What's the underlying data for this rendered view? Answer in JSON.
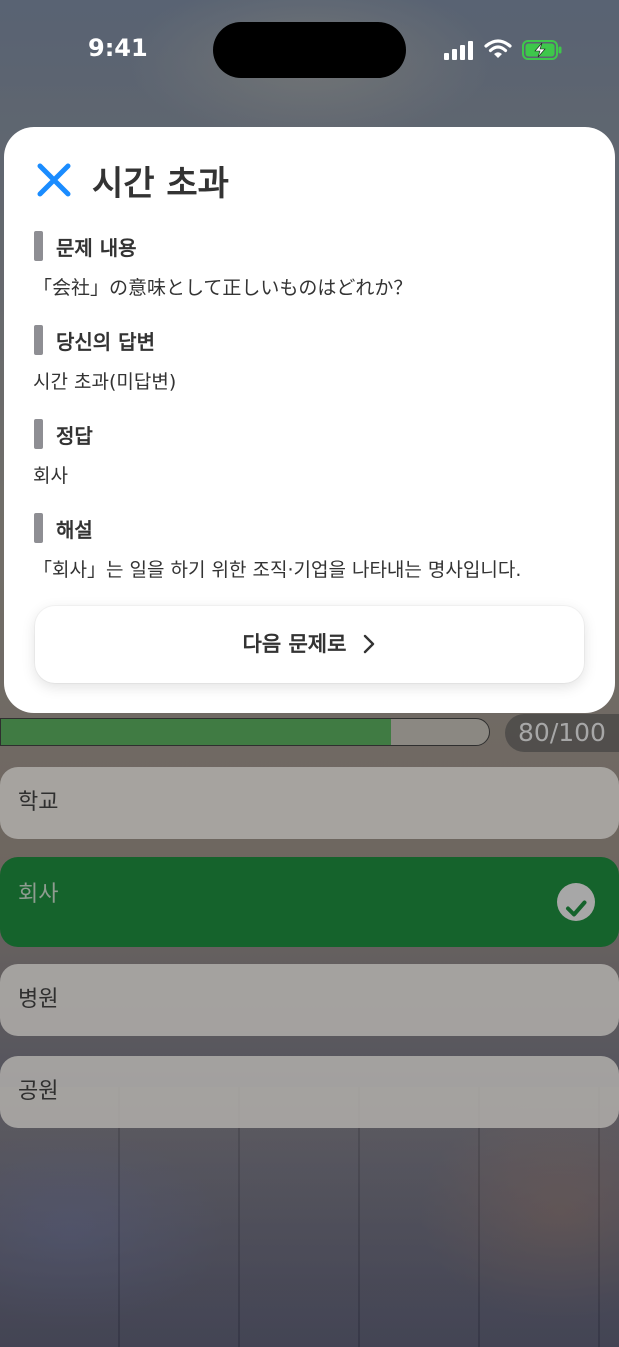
{
  "status_bar": {
    "time": "9:41"
  },
  "modal": {
    "title": "시간 초과",
    "sections": [
      {
        "label": "문제 내용",
        "value": "「会社」の意味として正しいものはどれか？"
      },
      {
        "label": "당신의 답변",
        "value": "시간 초과(미답변)"
      },
      {
        "label": "정답",
        "value": "회사"
      },
      {
        "label": "해설",
        "value": "「회사」는 일을 하기 위한 조직·기업을 나타내는 명사입니다."
      }
    ],
    "next_button": "다음 문제로"
  },
  "game": {
    "progress_fraction": 0.8,
    "score": "80/100",
    "options": [
      {
        "label": "학교",
        "correct": false
      },
      {
        "label": "회사",
        "correct": true
      },
      {
        "label": "병원",
        "correct": false
      },
      {
        "label": "공원",
        "correct": false
      }
    ]
  },
  "colors": {
    "accent": "#1a8cff",
    "correct": "#0e7a2e",
    "progress": "#4a9b4e",
    "battery": "#3ec74b"
  },
  "icons": [
    "close-icon",
    "check-icon",
    "chevron-right-icon",
    "signal-icon",
    "wifi-icon",
    "battery-icon"
  ]
}
